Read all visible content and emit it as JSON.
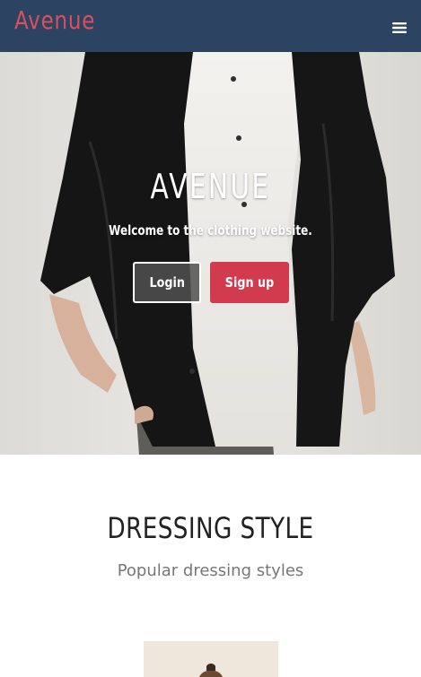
{
  "navbar": {
    "brand": "Avenue",
    "menu_icon": "hamburger-menu-icon"
  },
  "hero": {
    "title": "AVENUE",
    "subtitle": "Welcome to the clothing website.",
    "login_label": "Login",
    "signup_label": "Sign up"
  },
  "section": {
    "title": "DRESSING STYLE",
    "subtitle": "Popular dressing styles"
  },
  "colors": {
    "navbar_bg": "#2c4462",
    "brand": "#d8505e",
    "signup_bg": "#d23b4e",
    "login_bg": "#505050"
  }
}
